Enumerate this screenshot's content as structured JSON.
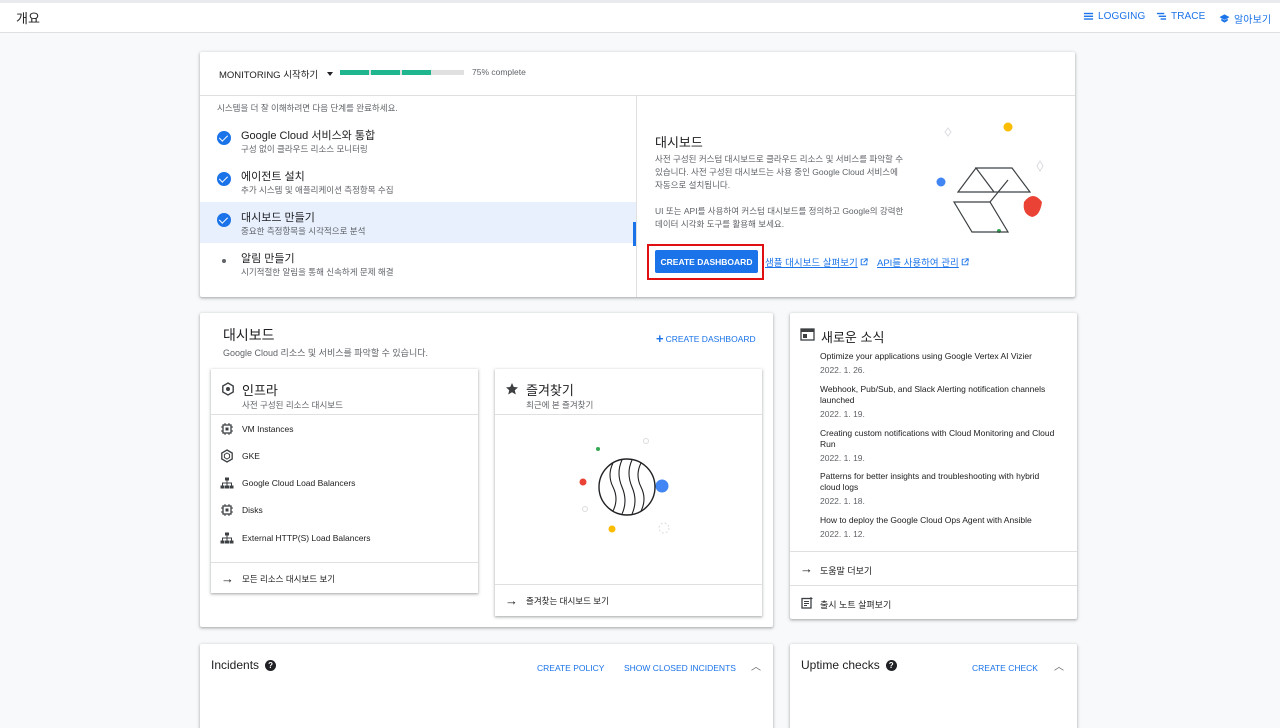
{
  "topbar": {
    "title": "개요",
    "links": [
      {
        "label": "LOGGING",
        "icon": "list-icon"
      },
      {
        "label": "TRACE",
        "icon": "trace-icon"
      },
      {
        "label": "알아보기",
        "icon": "school-icon"
      }
    ]
  },
  "getting_started": {
    "dropdown_label": "MONITORING 시작하기",
    "progress_label": "75% complete",
    "progress_fraction": 0.75,
    "intro": "시스템을 더 잘 이해하려면 다음 단계를 완료하세요.",
    "steps": [
      {
        "title": "Google Cloud 서비스와 통합",
        "subtitle": "구성 없이 클라우드 리소스 모니터링",
        "status": "done"
      },
      {
        "title": "에이전트 설치",
        "subtitle": "추가 시스템 및 애플리케이션 측정항목 수집",
        "status": "done"
      },
      {
        "title": "대시보드 만들기",
        "subtitle": "중요한 측정항목을 시각적으로 분석",
        "status": "done-active"
      },
      {
        "title": "알림 만들기",
        "subtitle": "시기적절한 알림을 통해 신속하게 문제 해결",
        "status": "todo"
      }
    ],
    "detail": {
      "heading": "대시보드",
      "para1": "사전 구성된 커스텀 대시보드로 클라우드 리소스 및 서비스를 파악할 수 있습니다. 사전 구성된 대시보드는 사용 중인 Google Cloud 서비스에 자동으로 설치됩니다.",
      "para2": "UI 또는 API를 사용하여 커스텀 대시보드를 정의하고 Google의 강력한 데이터 시각화 도구를 활용해 보세요.",
      "button": "CREATE DASHBOARD",
      "link1": "샘플 대시보드 살펴보기",
      "link2": "API를 사용하여 관리"
    }
  },
  "dashboards": {
    "heading": "대시보드",
    "subtitle": "Google Cloud 리소스 및 서비스를 파악할 수 있습니다.",
    "create": "CREATE DASHBOARD",
    "infra": {
      "title": "인프라",
      "subtitle": "사전 구성된 리소스 대시보드",
      "items": [
        "VM Instances",
        "GKE",
        "Google Cloud Load Balancers",
        "Disks",
        "External HTTP(S) Load Balancers"
      ],
      "footer": "모든 리소스 대시보드 보기"
    },
    "favorites": {
      "title": "즐겨찾기",
      "subtitle": "최근에 본 즐겨찾기",
      "footer": "즐겨찾는 대시보드 보기"
    }
  },
  "news": {
    "heading": "새로운 소식",
    "items": [
      {
        "title": "Optimize your applications using Google Vertex AI Vizier",
        "date": "2022. 1. 26."
      },
      {
        "title": "Webhook, Pub/Sub, and Slack Alerting notification channels launched",
        "date": "2022. 1. 19."
      },
      {
        "title": "Creating custom notifications with Cloud Monitoring and Cloud Run",
        "date": "2022. 1. 19."
      },
      {
        "title": "Patterns for better insights and troubleshooting with hybrid cloud logs",
        "date": "2022. 1. 18."
      },
      {
        "title": "How to deploy the Google Cloud Ops Agent with Ansible",
        "date": "2022. 1. 12."
      }
    ],
    "more": "도움말 더보기",
    "release_notes": "출시 노트 살펴보기"
  },
  "incidents": {
    "title": "Incidents",
    "create_policy": "CREATE POLICY",
    "show_closed": "SHOW CLOSED INCIDENTS"
  },
  "uptime": {
    "title": "Uptime checks",
    "create_check": "CREATE CHECK"
  },
  "colors": {
    "accent": "#1a73e8",
    "progress": "#1fb58f",
    "highlight_box": "#e01010"
  }
}
